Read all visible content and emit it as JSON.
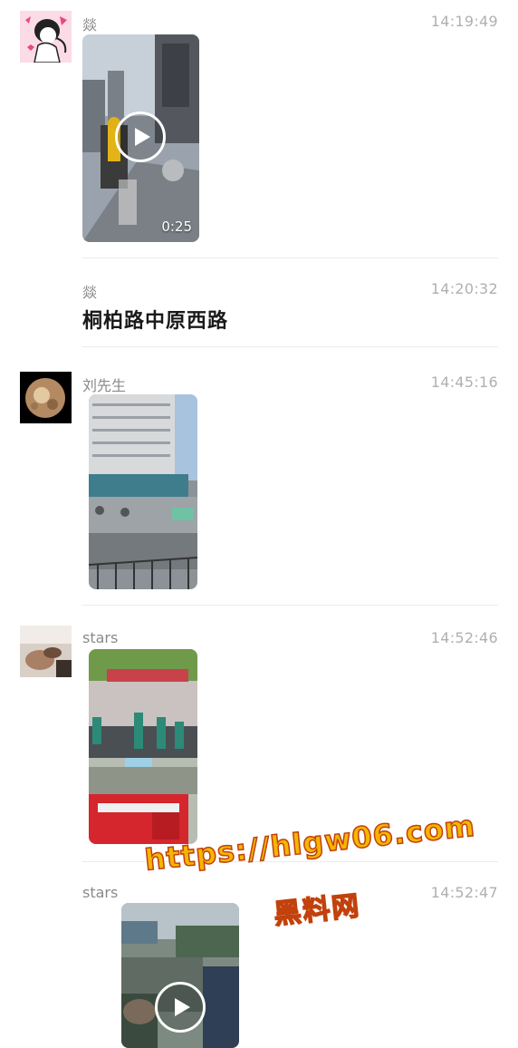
{
  "messages": [
    {
      "sender": "燚",
      "time": "14:19:49",
      "type": "video",
      "duration": "0:25",
      "avatar_icon": "anime-girl-avatar"
    },
    {
      "sender": "燚",
      "time": "14:20:32",
      "type": "text",
      "text": "桐柏路中原西路"
    },
    {
      "sender": "刘先生",
      "time": "14:45:16",
      "type": "image",
      "avatar_icon": "planet-avatar"
    },
    {
      "sender": "stars",
      "time": "14:52:46",
      "type": "image",
      "avatar_icon": "photo-avatar"
    },
    {
      "sender": "stars",
      "time": "14:52:47",
      "type": "video"
    }
  ],
  "watermark": {
    "line1": "https://hlgw06.com",
    "line2": "黑料网"
  }
}
